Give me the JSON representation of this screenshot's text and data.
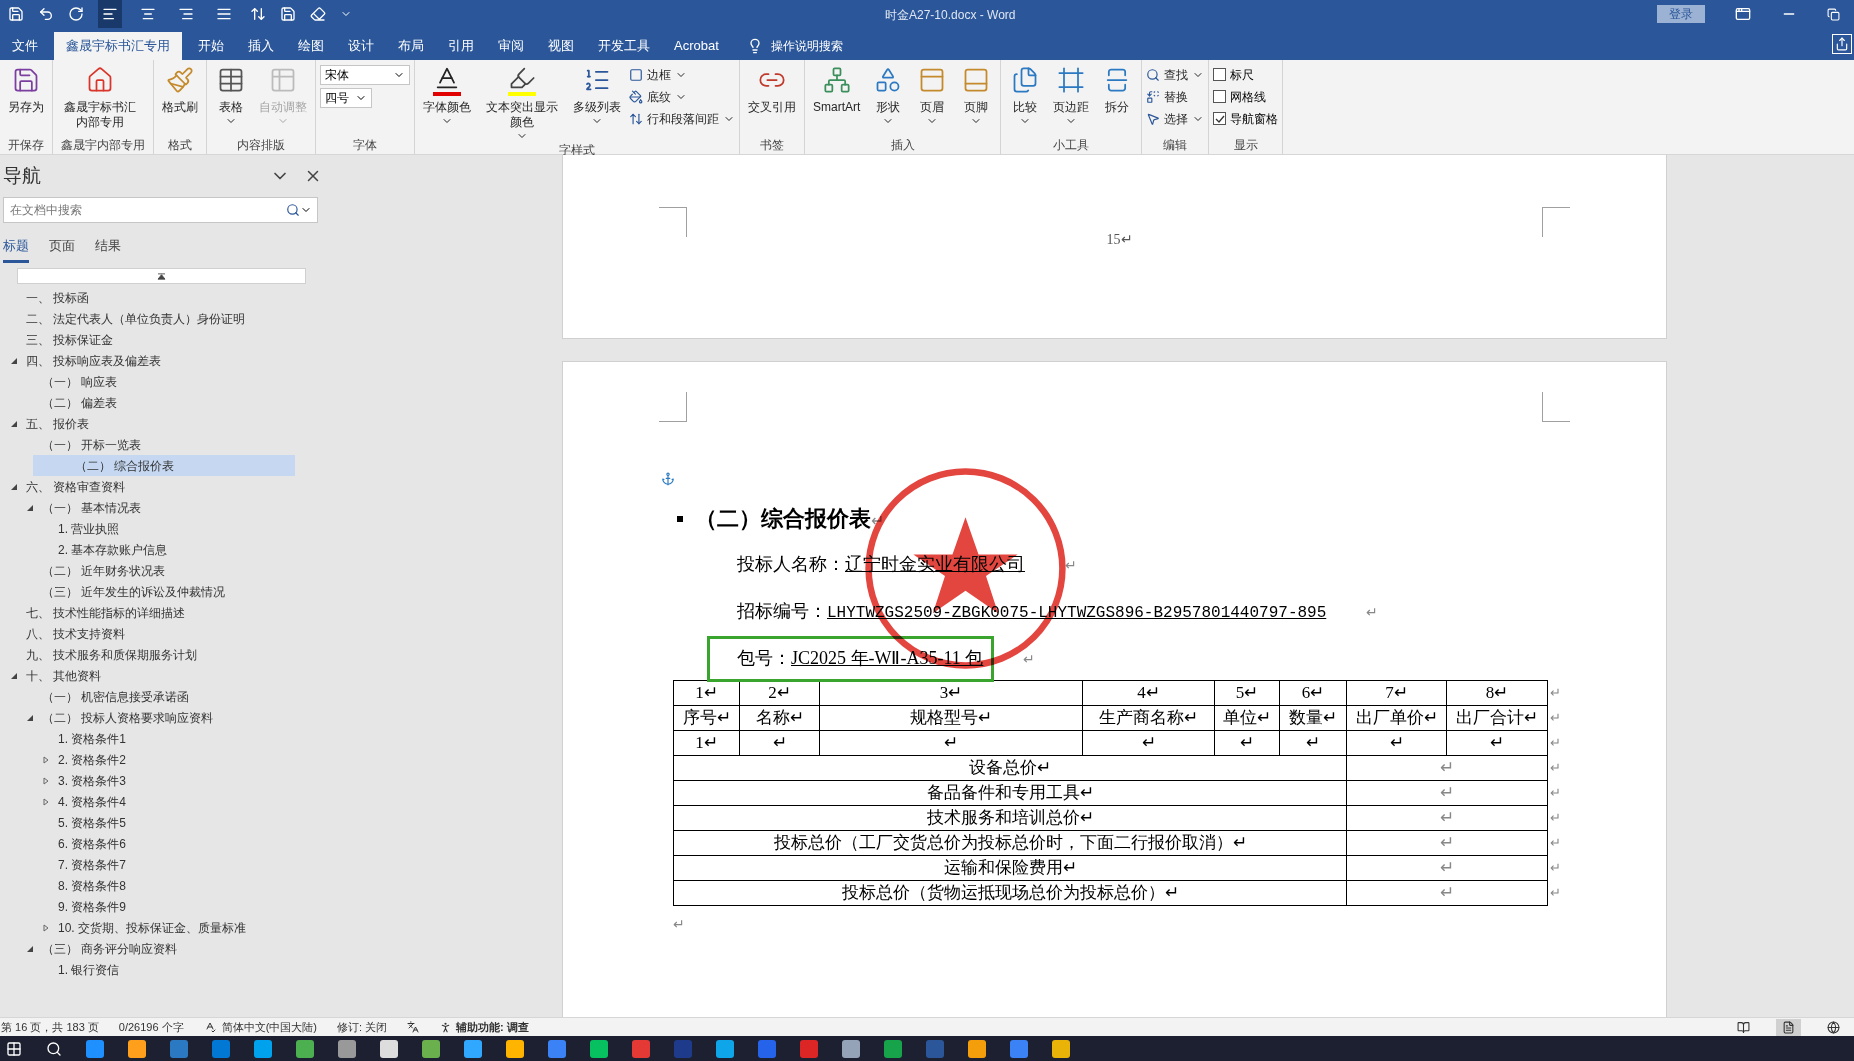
{
  "window": {
    "title": "时金A27-10.docx  -  Word",
    "login": "登录"
  },
  "quick_access_alignment": [
    {
      "selected": true
    },
    {
      "selected": false
    },
    {
      "selected": false
    },
    {
      "selected": false
    }
  ],
  "tabs": [
    {
      "label": "文件",
      "selected": false
    },
    {
      "label": "鑫晟宇标书汇专用",
      "selected": true
    },
    {
      "label": "开始",
      "selected": false
    },
    {
      "label": "插入",
      "selected": false
    },
    {
      "label": "绘图",
      "selected": false
    },
    {
      "label": "设计",
      "selected": false
    },
    {
      "label": "布局",
      "selected": false
    },
    {
      "label": "引用",
      "selected": false
    },
    {
      "label": "审阅",
      "selected": false
    },
    {
      "label": "视图",
      "selected": false
    },
    {
      "label": "开发工具",
      "selected": false
    },
    {
      "label": "Acrobat",
      "selected": false
    }
  ],
  "tell_me": "操作说明搜索",
  "ribbon": [
    {
      "label": "开保存",
      "items": [
        {
          "kind": "large",
          "label": "另存为",
          "caret": false,
          "disabled": false
        }
      ]
    },
    {
      "label": "鑫晟宇内部专用",
      "items": [
        {
          "kind": "large",
          "label": "鑫晟宇标书汇内部专用",
          "caret": false,
          "disabled": false
        }
      ]
    },
    {
      "label": "格式",
      "items": [
        {
          "kind": "large",
          "label": "格式刷",
          "caret": false,
          "disabled": false
        }
      ]
    },
    {
      "label": "内容排版",
      "items": [
        {
          "kind": "large",
          "label": "表格",
          "caret": true,
          "disabled": false
        },
        {
          "kind": "large",
          "label": "自动调整",
          "caret": true,
          "disabled": true
        }
      ]
    },
    {
      "label": "字体",
      "items": [
        {
          "kind": "combo",
          "value": "宋体"
        },
        {
          "kind": "combo",
          "value": "四号"
        }
      ]
    },
    {
      "label": "字样式",
      "items": [
        {
          "kind": "large",
          "label": "字体颜色",
          "caret": true,
          "disabled": false
        },
        {
          "kind": "large",
          "label": "文本突出显示颜色",
          "caret": true,
          "disabled": false
        },
        {
          "kind": "large",
          "label": "多级列表",
          "caret": true,
          "disabled": false
        },
        {
          "kind": "small",
          "label": "边框",
          "caret": true
        },
        {
          "kind": "small",
          "label": "底纹",
          "caret": true
        },
        {
          "kind": "small",
          "label": "行和段落间距",
          "caret": true
        }
      ]
    },
    {
      "label": "书签",
      "items": [
        {
          "kind": "large",
          "label": "交叉引用",
          "caret": false,
          "disabled": false
        }
      ]
    },
    {
      "label": "插入",
      "items": [
        {
          "kind": "large",
          "label": "SmartArt",
          "caret": false,
          "disabled": false
        },
        {
          "kind": "large",
          "label": "形状",
          "caret": true,
          "disabled": false
        },
        {
          "kind": "large",
          "label": "页眉",
          "caret": true,
          "disabled": false
        },
        {
          "kind": "large",
          "label": "页脚",
          "caret": true,
          "disabled": false
        }
      ]
    },
    {
      "label": "小工具",
      "items": [
        {
          "kind": "large",
          "label": "比较",
          "caret": true,
          "disabled": false
        },
        {
          "kind": "large",
          "label": "页边距",
          "caret": true,
          "disabled": false
        },
        {
          "kind": "large",
          "label": "拆分",
          "caret": false,
          "disabled": false
        }
      ]
    },
    {
      "label": "编辑",
      "items": [
        {
          "kind": "small",
          "label": "查找",
          "caret": true
        },
        {
          "kind": "small",
          "label": "替换",
          "caret": false
        },
        {
          "kind": "small",
          "label": "选择",
          "caret": true
        }
      ]
    },
    {
      "label": "显示",
      "items": [
        {
          "kind": "checkbox",
          "label": "标尺",
          "checked": false
        },
        {
          "kind": "checkbox",
          "label": "网格线",
          "checked": false
        },
        {
          "kind": "checkbox",
          "label": "导航窗格",
          "checked": true
        }
      ]
    }
  ],
  "nav": {
    "title": "导航",
    "search_placeholder": "在文档中搜索",
    "tabs": [
      {
        "label": "标题",
        "selected": true
      },
      {
        "label": "页面",
        "selected": false
      },
      {
        "label": "结果",
        "selected": false
      }
    ],
    "tree": [
      {
        "label": "一、 投标函",
        "selected": false
      },
      {
        "label": "二、 法定代表人（单位负责人）身份证明",
        "selected": false
      },
      {
        "label": "三、 投标保证金",
        "selected": false
      },
      {
        "label": "四、 投标响应表及偏差表",
        "selected": false,
        "expanded": true,
        "children": [
          {
            "label": "（一） 响应表",
            "selected": false
          },
          {
            "label": "（二） 偏差表",
            "selected": false
          }
        ]
      },
      {
        "label": "五、 报价表",
        "selected": false,
        "expanded": true,
        "children": [
          {
            "label": "（一） 开标一览表",
            "selected": false
          },
          {
            "label": "（二） 综合报价表",
            "selected": true
          }
        ]
      },
      {
        "label": "六、 资格审查资料",
        "selected": false,
        "expanded": true,
        "children": [
          {
            "label": "（一） 基本情况表",
            "selected": false,
            "expanded": true,
            "children": [
              {
                "label": "1. 营业执照",
                "selected": false
              },
              {
                "label": "2. 基本存款账户信息",
                "selected": false
              }
            ]
          },
          {
            "label": "（二） 近年财务状况表",
            "selected": false
          },
          {
            "label": "（三） 近年发生的诉讼及仲裁情况",
            "selected": false
          }
        ]
      },
      {
        "label": "七、 技术性能指标的详细描述",
        "selected": false
      },
      {
        "label": "八、 技术支持资料",
        "selected": false
      },
      {
        "label": "九、 技术服务和质保期服务计划",
        "selected": false
      },
      {
        "label": "十、 其他资料",
        "selected": false,
        "expanded": true,
        "children": [
          {
            "label": "（一） 机密信息接受承诺函",
            "selected": false
          },
          {
            "label": "（二） 投标人资格要求响应资料",
            "selected": false,
            "expanded": true,
            "children": [
              {
                "label": "1. 资格条件1",
                "selected": false
              },
              {
                "label": "2. 资格条件2",
                "selected": false,
                "expanded": false
              },
              {
                "label": "3. 资格条件3",
                "selected": false,
                "expanded": false
              },
              {
                "label": "4. 资格条件4",
                "selected": false,
                "expanded": false
              },
              {
                "label": "5. 资格条件5",
                "selected": false
              },
              {
                "label": "6. 资格条件6",
                "selected": false
              },
              {
                "label": "7. 资格条件7",
                "selected": false
              },
              {
                "label": "8. 资格条件8",
                "selected": false
              },
              {
                "label": "9. 资格条件9",
                "selected": false
              },
              {
                "label": "10. 交货期、投标保证金、质量标准",
                "selected": false,
                "expanded": false
              }
            ]
          },
          {
            "label": "（三） 商务评分响应资料",
            "selected": false,
            "expanded": true,
            "children": [
              {
                "label": "1. 银行资信",
                "selected": false
              }
            ]
          }
        ]
      }
    ]
  },
  "document": {
    "page_number": "15↵",
    "heading": "（二）综合报价表",
    "heading_mark": "↵",
    "fields": [
      {
        "label": "投标人名称：",
        "value": "辽宁时金实业有限公司",
        "mark": "↵"
      },
      {
        "label": "招标编号：",
        "value": "LHYTWZGS2509-ZBGK0075-LHYTWZGS896-B2957801440797-895",
        "mark": "↵"
      },
      {
        "label": "包号：",
        "value": "JC2025 年-WⅡ-A35-11 包",
        "mark": "↵"
      }
    ],
    "table": {
      "rows": [
        {
          "cells": [
            "1↵",
            "2↵",
            "3↵",
            "4↵",
            "5↵",
            "6↵",
            "7↵",
            "8↵"
          ],
          "end_mark": "↵"
        },
        {
          "cells": [
            "序号↵",
            "名称↵",
            "规格型号↵",
            "生产商名称↵",
            "单位↵",
            "数量↵",
            "出厂单价↵",
            "出厂合计↵"
          ],
          "end_mark": "↵"
        },
        {
          "cells": [
            "1↵",
            "↵",
            "↵",
            "↵",
            "↵",
            "↵",
            "↵",
            "↵"
          ],
          "end_mark": "↵"
        }
      ],
      "summary_rows": [
        {
          "label": "设备总价↵",
          "value": "↵",
          "end_mark": "↵"
        },
        {
          "label": "备品备件和专用工具↵",
          "value": "↵",
          "end_mark": "↵"
        },
        {
          "label": "技术服务和培训总价↵",
          "value": "↵",
          "end_mark": "↵"
        },
        {
          "label": "投标总价（工厂交货总价为投标总价时，下面二行报价取消）↵",
          "value": "↵",
          "end_mark": "↵"
        },
        {
          "label": "运输和保险费用↵",
          "value": "↵",
          "end_mark": "↵"
        },
        {
          "label": "投标总价（货物运抵现场总价为投标总价）↵",
          "value": "↵",
          "end_mark": "↵"
        }
      ]
    },
    "after_table": "↵"
  },
  "status_bar": {
    "page": "第 16 页，共 183 页",
    "words": "0/26196 个字",
    "language": "简体中文(中国大陆)",
    "track_changes": "修订: 关闭",
    "accessibility": "辅助功能: 调查",
    "views": [
      {
        "selected": false
      },
      {
        "selected": true
      },
      {
        "selected": false
      }
    ]
  }
}
